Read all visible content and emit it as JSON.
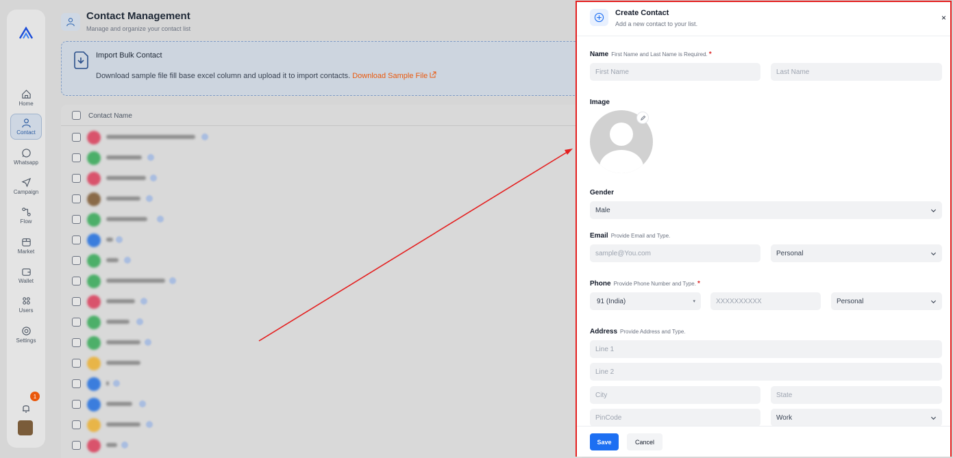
{
  "sidebar": {
    "items": [
      {
        "label": "Home",
        "icon": "home-icon"
      },
      {
        "label": "Contact",
        "icon": "user-icon"
      },
      {
        "label": "Whatsapp",
        "icon": "whatsapp-icon"
      },
      {
        "label": "Campaign",
        "icon": "send-icon"
      },
      {
        "label": "Flow",
        "icon": "flow-icon"
      },
      {
        "label": "Market",
        "icon": "store-icon"
      },
      {
        "label": "Wallet",
        "icon": "wallet-icon"
      },
      {
        "label": "Users",
        "icon": "users-icon"
      },
      {
        "label": "Settings",
        "icon": "gear-icon"
      }
    ],
    "notification_count": "1",
    "active": "Contact"
  },
  "header": {
    "title": "Contact Management",
    "subtitle": "Manage and organize your contact list"
  },
  "import": {
    "title": "Import Bulk Contact",
    "text": "Download sample file fill base excel column and upload it to import contacts.",
    "link": "Download Sample File"
  },
  "table": {
    "column_header": "Contact Name"
  },
  "panel": {
    "title": "Create Contact",
    "subtitle": "Add a new contact to your list.",
    "close": "×",
    "name": {
      "label": "Name",
      "hint": "First Name and Last Name is Required.",
      "required": "*",
      "first_placeholder": "First Name",
      "last_placeholder": "Last Name"
    },
    "image": {
      "label": "Image"
    },
    "gender": {
      "label": "Gender",
      "value": "Male"
    },
    "email": {
      "label": "Email",
      "hint": "Provide Email and Type.",
      "placeholder": "sample@You.com",
      "type": "Personal"
    },
    "phone": {
      "label": "Phone",
      "hint": "Provide Phone Number and Type.",
      "required": "*",
      "country": "91 (India)",
      "placeholder": "XXXXXXXXXX",
      "type": "Personal"
    },
    "address": {
      "label": "Address",
      "hint": "Provide Address and Type.",
      "line1": "Line 1",
      "line2": "Line 2",
      "city": "City",
      "state": "State",
      "pincode": "PinCode",
      "type": "Work"
    },
    "save": "Save",
    "cancel": "Cancel"
  },
  "colors": {
    "accent": "#1d6ff2",
    "highlight_border": "#e41e1e",
    "link": "#ea580c"
  }
}
